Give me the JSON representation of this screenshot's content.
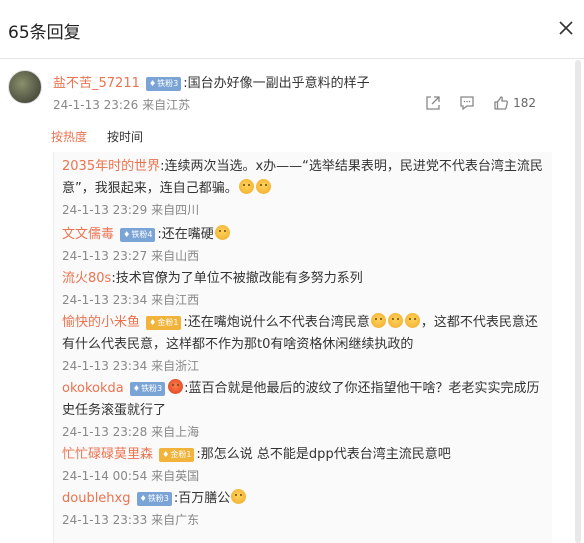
{
  "header": {
    "title": "65条回复"
  },
  "main_comment": {
    "username": "盐不苦_57211",
    "badge": "铁粉3",
    "text": ":国台办好像一副出乎意料的样子",
    "time": "24-1-13 23:26",
    "location": "来自江苏",
    "like_count": "182"
  },
  "sort": {
    "hot": "按热度",
    "time": "按时间"
  },
  "replies": [
    {
      "username": "2035年时的世界",
      "text": ":连续两次当选。x办——“选举结果表明，民进党不代表台湾主流民意”，我狠起来，连自己都骗。",
      "time": "24-1-13 23:29",
      "location": "来自四川"
    },
    {
      "username": "文文儒毒",
      "badge": "铁粉4",
      "text": ":还在嘴硬",
      "time": "24-1-13 23:27",
      "location": "来自山西"
    },
    {
      "username": "流火80s",
      "text": ":技术官僚为了单位不被撤改能有多努力系列",
      "time": "24-1-13 23:34",
      "location": "来自江西"
    },
    {
      "username": "愉快的小米鱼",
      "badge": "金粉1",
      "text": ":还在嘴炮说什么不代表台湾民意",
      "text2": "，这都不代表民意还有什么代表民意，这样都不作为那t0有啥资格休闲继续执政的",
      "time": "24-1-13 23:34",
      "location": "来自浙江"
    },
    {
      "username": "okokokda",
      "badge": "铁粉3",
      "text": ":蓝百合就是他最后的波纹了你还指望他干啥？老老实实完成历史任务滚蛋就行了",
      "time": "24-1-13 23:28",
      "location": "来自上海"
    },
    {
      "username": "忙忙碌碌莫里森",
      "badge": "金粉1",
      "text": ":那怎么说 总不能是dpp代表台湾主流民意吧",
      "time": "24-1-14 00:54",
      "location": "来自英国"
    },
    {
      "username": "doublehxg",
      "badge": "铁粉3",
      "text": ":百万膳公",
      "time": "24-1-13 23:33",
      "location": "来自广东"
    }
  ],
  "icons": {
    "close": "close-icon",
    "share": "share-icon",
    "comment": "comment-icon",
    "like": "like-icon"
  },
  "colors": {
    "username": "#eb7350",
    "meta": "#888888",
    "iron_badge": "#7aa4d6",
    "gold_badge": "#f1b33a"
  }
}
